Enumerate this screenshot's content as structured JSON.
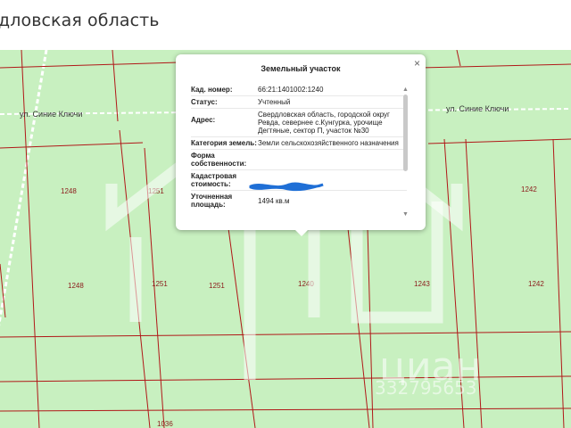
{
  "header": {
    "title": "дловская область"
  },
  "map": {
    "roads": [
      {
        "name": "ул. Синие Ключи"
      },
      {
        "name": "ул. Синие Ключи"
      }
    ],
    "parcels": [
      "1248",
      "1251",
      "1242",
      "1248",
      "1251",
      "1251",
      "1240",
      "1243",
      "1242",
      "1036"
    ]
  },
  "watermark": {
    "brand": "циан",
    "phone": "332795653"
  },
  "popup": {
    "title": "Земельный участок",
    "close": "×",
    "rows": [
      {
        "key": "Кад. номер:",
        "value": "66:21:1401002:1240"
      },
      {
        "key": "Статус:",
        "value": "Учтенный"
      },
      {
        "key": "Адрес:",
        "value": "Свердловская область, городской округ Ревда, севернее с.Кунгурка, урочище Дегтяные, сектор П, участок №30"
      },
      {
        "key": "Категория земель:",
        "value": "Земли сельскохозяйственного назначения"
      },
      {
        "key": "Форма собственности:",
        "value": ""
      },
      {
        "key": "Кадастровая стоимость:",
        "value": ""
      },
      {
        "key": "Уточненная площадь:",
        "value": "1494 кв.м"
      }
    ]
  },
  "colors": {
    "land": "#c8f0c0",
    "boundary": "#b01818",
    "road": "#ffffff"
  }
}
